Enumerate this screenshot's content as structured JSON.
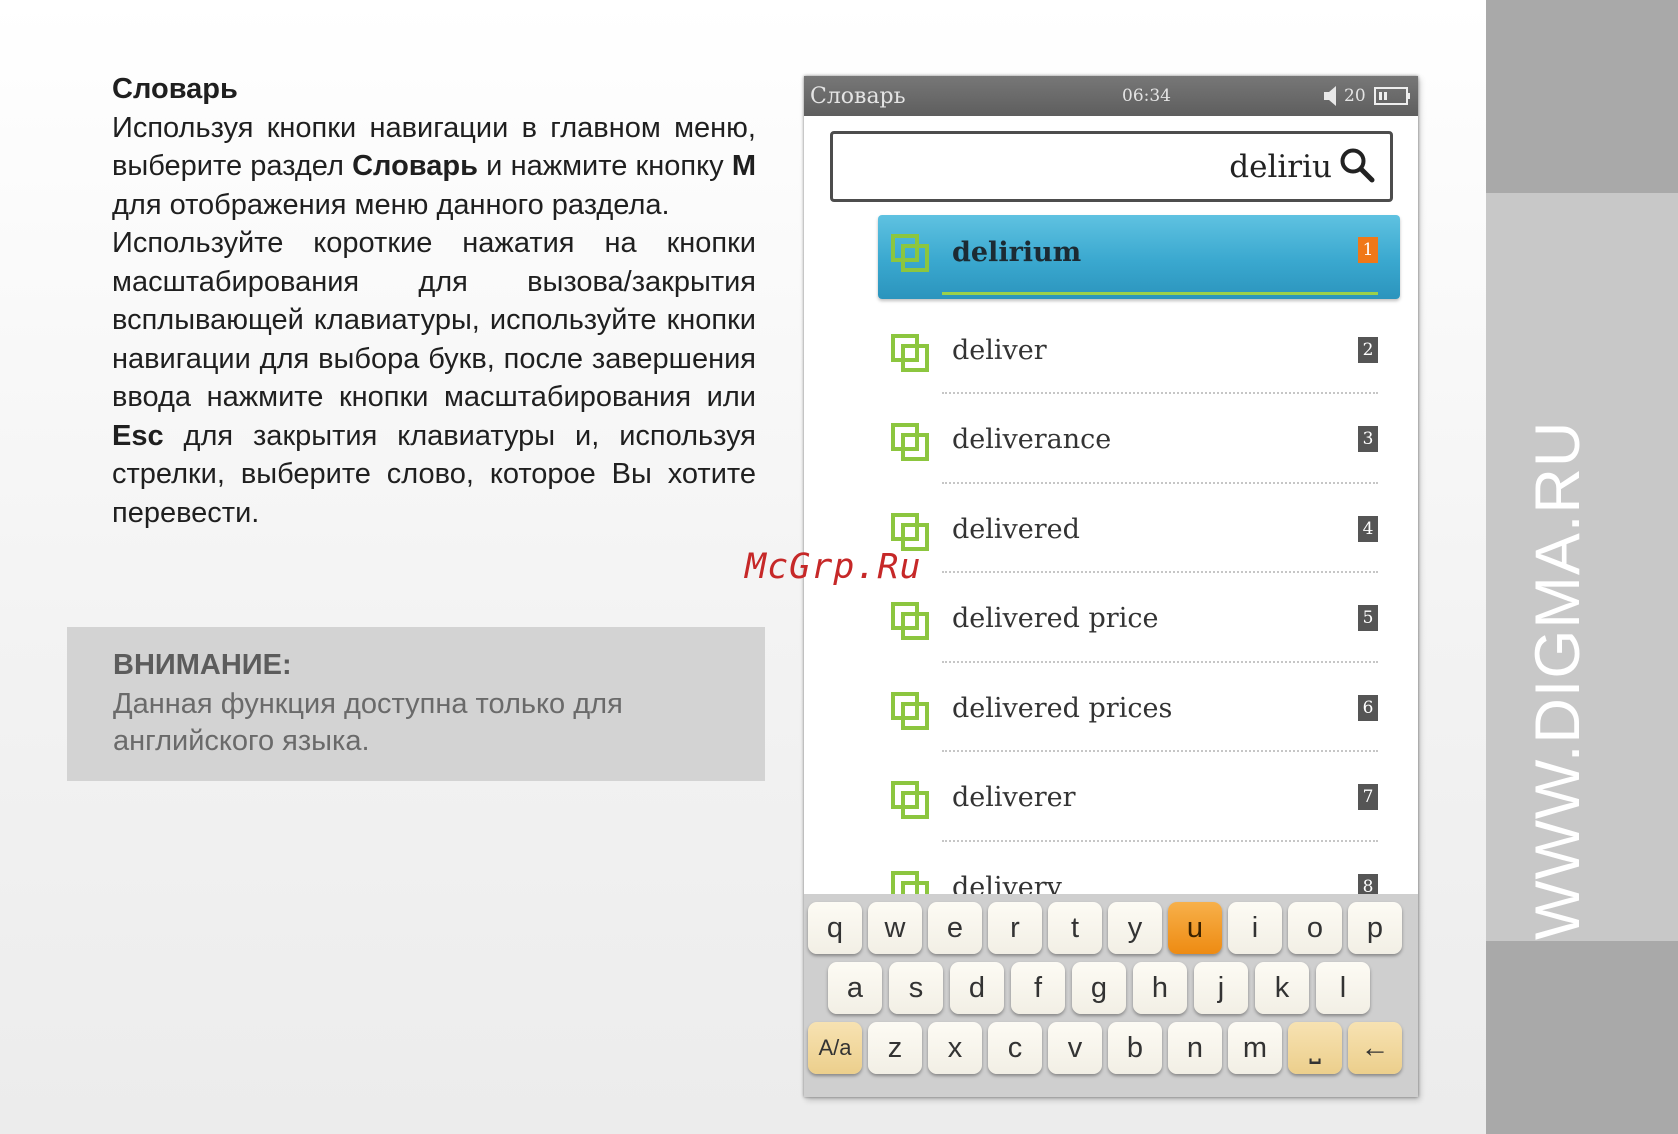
{
  "manual": {
    "heading": "Словарь",
    "p1": {
      "pre": "Используя кнопки навигации в главном меню, выберите раздел",
      "bold": "Словарь",
      "post": "и нажмите кнопку",
      "bold2": "M",
      "post2": "для отображения меню данного раздела."
    },
    "p2": {
      "pre": "Используйте короткие нажатия на кнопки масштабирования для вызова/закрытия всплывающей клавиатуры, используйте кнопки навигации для выбора букв, после завершения ввода нажмите кнопки масштабирования или",
      "bold": "Esc",
      "post": "для закрытия клавиатуры и, используя стрелки, выберите слово, которое Вы хотите перевести."
    },
    "note_title": "ВНИМАНИЕ:",
    "note_text": "Данная функция доступна только для английского языка."
  },
  "watermark": "McGrp.Ru",
  "side_url": "WWW.DIGMA.RU",
  "device": {
    "status_title": "Словарь",
    "time": "06:34",
    "volume": "20",
    "search_value": "deliriu",
    "results": [
      {
        "word": "delirium",
        "num": "1"
      },
      {
        "word": "deliver",
        "num": "2"
      },
      {
        "word": "deliverance",
        "num": "3"
      },
      {
        "word": "delivered",
        "num": "4"
      },
      {
        "word": "delivered price",
        "num": "5"
      },
      {
        "word": "delivered prices",
        "num": "6"
      },
      {
        "word": "deliverer",
        "num": "7"
      },
      {
        "word": "delivery",
        "num": "8"
      }
    ],
    "keyboard": {
      "row1": [
        "q",
        "w",
        "e",
        "r",
        "t",
        "y",
        "u",
        "i",
        "o",
        "p"
      ],
      "row2": [
        "a",
        "s",
        "d",
        "f",
        "g",
        "h",
        "j",
        "k",
        "l"
      ],
      "row3": [
        "A/a",
        "z",
        "x",
        "c",
        "v",
        "b",
        "n",
        "m",
        "⎵",
        "←"
      ],
      "active_key": "u"
    }
  },
  "colors": {
    "selected_row": "#3aa8cf",
    "icon_green": "#8cc63f",
    "active_key": "#ee8b12",
    "watermark": "#c62828"
  }
}
